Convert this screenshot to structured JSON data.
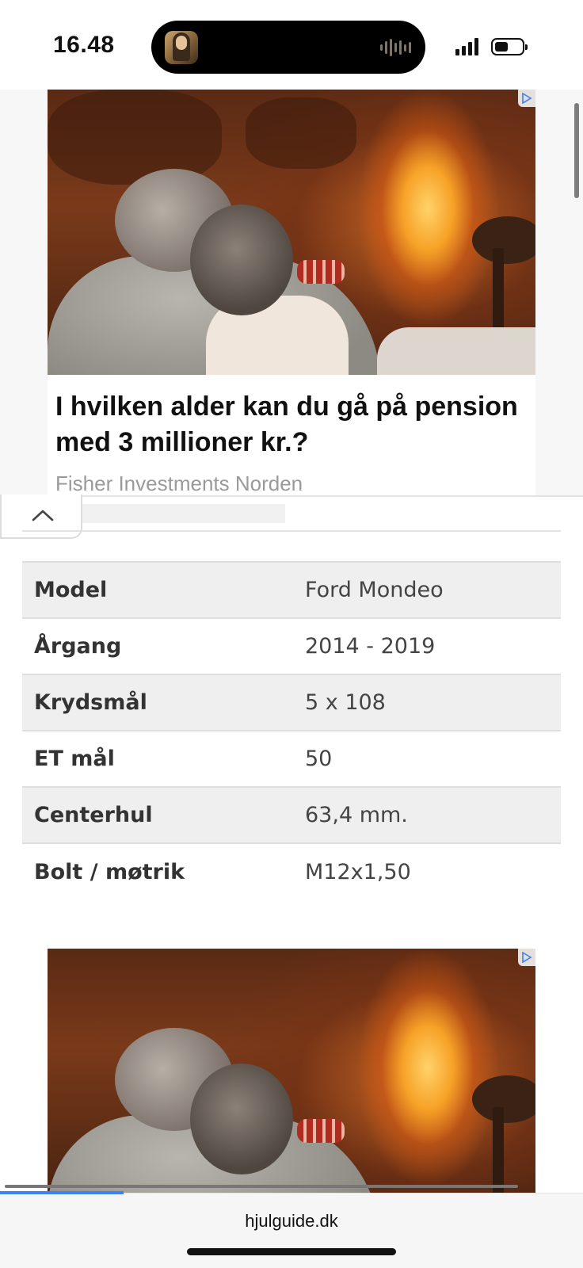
{
  "status_bar": {
    "time": "16.48",
    "icons": [
      "now-playing-thumbnail-icon",
      "audio-waveform-icon",
      "cellular-signal-icon",
      "battery-icon"
    ]
  },
  "ad": {
    "title": "I hvilken alder kan du gå på pension med 3 millioner kr.?",
    "source": "Fisher Investments Norden",
    "adchoice_icon": "adchoices-icon"
  },
  "collapse_icon": "chevron-up-icon",
  "specs": [
    {
      "key": "Model",
      "value": "Ford Mondeo"
    },
    {
      "key": "Årgang",
      "value": "2014 - 2019"
    },
    {
      "key": "Krydsmål",
      "value": "5 x 108"
    },
    {
      "key": "ET mål",
      "value": "50"
    },
    {
      "key": "Centerhul",
      "value": "63,4 mm."
    },
    {
      "key": "Bolt / møtrik",
      "value": "M12x1,50"
    }
  ],
  "browser": {
    "url": "hjulguide.dk",
    "load_progress": 0.23,
    "accent_color": "#3b82f6"
  }
}
